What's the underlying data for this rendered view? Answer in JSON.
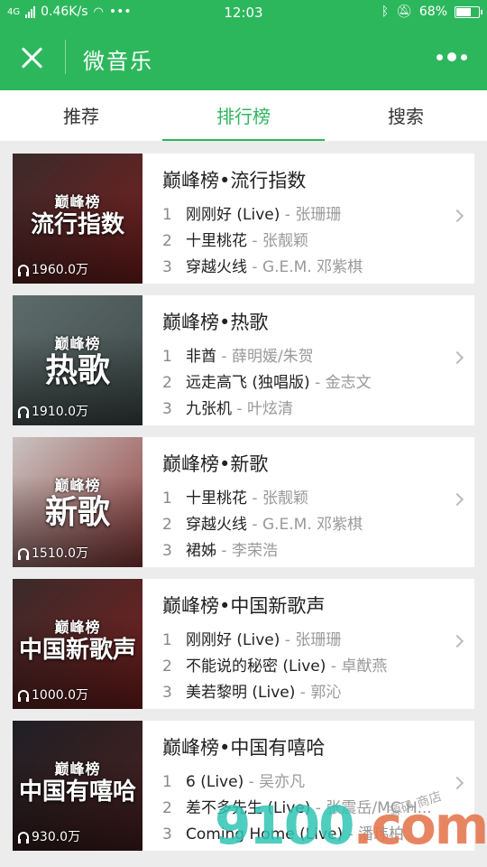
{
  "status": {
    "network": "4G",
    "speed": "0.46K/s",
    "dots": "•••",
    "time": "12:03",
    "battery": "68%",
    "battery_level": 0.68
  },
  "header": {
    "title": "微音乐"
  },
  "tabs": [
    {
      "label": "推荐"
    },
    {
      "label": "排行榜"
    },
    {
      "label": "搜索"
    }
  ],
  "charts": [
    {
      "cover_logo": "巅峰榜",
      "cover_title": "流行指数",
      "play_count": "1960.0万",
      "title": "巅峰榜•流行指数",
      "colors": [
        "#3a2a2a",
        "#7a1f1f"
      ],
      "songs": [
        {
          "idx": "1",
          "name": "刚刚好 (Live)",
          "artist": "张珊珊"
        },
        {
          "idx": "2",
          "name": "十里桃花",
          "artist": "张靓颖"
        },
        {
          "idx": "3",
          "name": "穿越火线",
          "artist": "G.E.M. 邓紫棋"
        }
      ]
    },
    {
      "cover_logo": "巅峰榜",
      "cover_title": "热歌",
      "play_count": "1910.0万",
      "title": "巅峰榜•热歌",
      "colors": [
        "#5d6b6a",
        "#3f4b4a"
      ],
      "songs": [
        {
          "idx": "1",
          "name": "非酋",
          "artist": "薛明媛/朱贺"
        },
        {
          "idx": "2",
          "name": "远走高飞 (独唱版)",
          "artist": "金志文"
        },
        {
          "idx": "3",
          "name": "九张机",
          "artist": "叶炫清"
        }
      ]
    },
    {
      "cover_logo": "巅峰榜",
      "cover_title": "新歌",
      "play_count": "1510.0万",
      "title": "巅峰榜•新歌",
      "colors": [
        "#c9c3c0",
        "#8c3a3a"
      ],
      "songs": [
        {
          "idx": "1",
          "name": "十里桃花",
          "artist": "张靓颖"
        },
        {
          "idx": "2",
          "name": "穿越火线",
          "artist": "G.E.M. 邓紫棋"
        },
        {
          "idx": "3",
          "name": "裙姊",
          "artist": "李荣浩"
        }
      ]
    },
    {
      "cover_logo": "巅峰榜",
      "cover_title": "中国新歌声",
      "play_count": "1000.0万",
      "title": "巅峰榜•中国新歌声",
      "colors": [
        "#3a2a2a",
        "#7a1f1f"
      ],
      "songs": [
        {
          "idx": "1",
          "name": "刚刚好 (Live)",
          "artist": "张珊珊"
        },
        {
          "idx": "2",
          "name": "不能说的秘密 (Live)",
          "artist": "卓猷燕"
        },
        {
          "idx": "3",
          "name": "美若黎明 (Live)",
          "artist": "郭沁"
        }
      ]
    },
    {
      "cover_logo": "巅峰榜",
      "cover_title": "中国有嘻哈",
      "play_count": "930.0万",
      "title": "巅峰榜•中国有嘻哈",
      "colors": [
        "#1f1f24",
        "#4a2020"
      ],
      "songs": [
        {
          "idx": "1",
          "name": "6 (Live)",
          "artist": "吴亦凡"
        },
        {
          "idx": "2",
          "name": "差不多先生 (Live)",
          "artist": "张震岳/MC H..."
        },
        {
          "idx": "3",
          "name": "Coming Home (Live)",
          "artist": "潘玮柏"
        }
      ]
    }
  ],
  "watermark": {
    "main": "9100",
    "dot": ".com",
    "sub": "源码 商店"
  },
  "accent_color": "#2db75c"
}
